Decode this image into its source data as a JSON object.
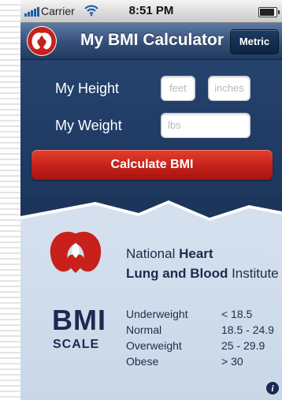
{
  "status_bar": {
    "carrier": "Carrier",
    "time": "8:51 PM",
    "icons": [
      "signal-bars-icon",
      "wifi-icon",
      "battery-icon"
    ]
  },
  "nav": {
    "title": "My BMI Calculator",
    "metric_button": "Metric",
    "logo_icon": "heart-lungs-logo-icon"
  },
  "form": {
    "height_label": "My Height",
    "weight_label": "My Weight",
    "feet_placeholder": "feet",
    "inches_placeholder": "inches",
    "lbs_placeholder": "lbs",
    "calculate_button": "Calculate BMI"
  },
  "org": {
    "line1_prefix": "National ",
    "line1_bold": "Heart",
    "line2_bold": "Lung and Blood",
    "line2_suffix": " Institute"
  },
  "bmi": {
    "big_text": "BMI",
    "scale_text": "SCALE",
    "rows": [
      {
        "category": "Underweight",
        "range": "< 18.5"
      },
      {
        "category": "Normal",
        "range": "18.5 - 24.9"
      },
      {
        "category": "Overweight",
        "range": "25 - 29.9"
      },
      {
        "category": "Obese",
        "range": "> 30"
      }
    ]
  },
  "footer": {
    "info_icon": "i"
  },
  "colors": {
    "nav_blue": "#344f78",
    "form_blue": "#1f3a63",
    "calc_red": "#c3211a",
    "panel_blue": "#d4e0ee",
    "text_navy": "#1b2a52"
  }
}
